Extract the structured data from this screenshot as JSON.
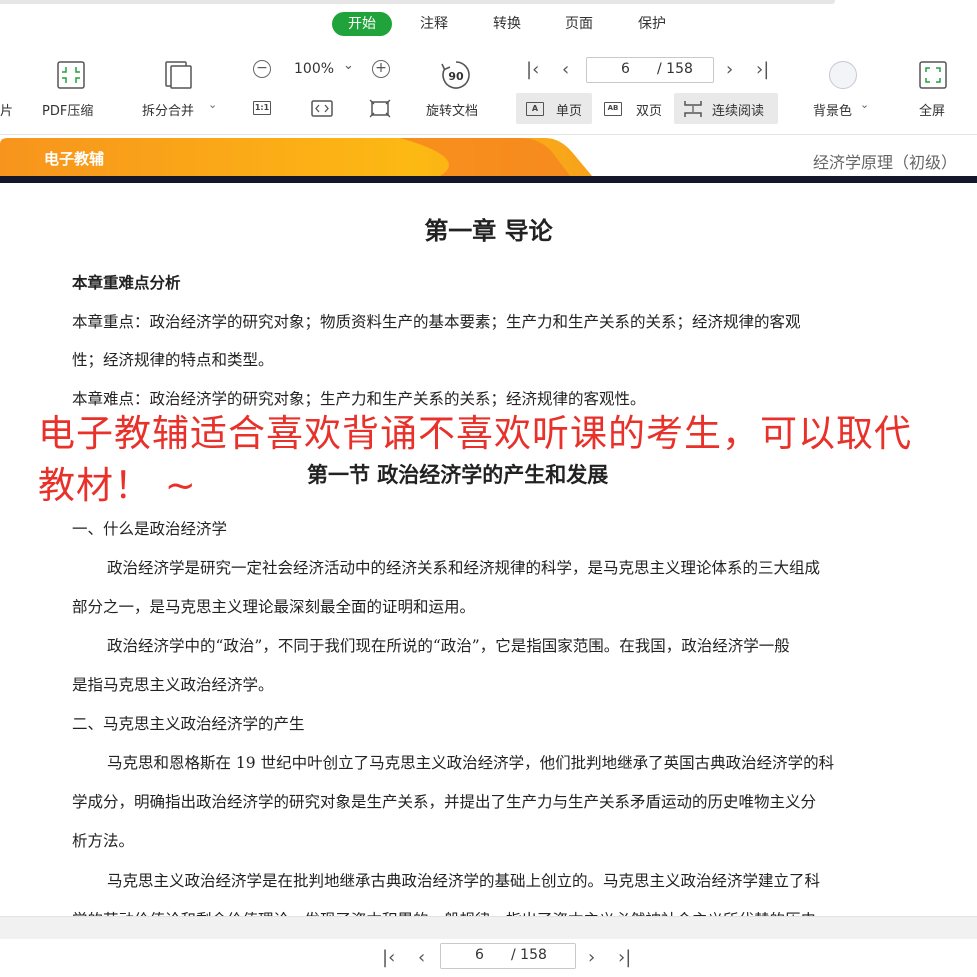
{
  "tabs": [
    {
      "label": "开始",
      "active": true
    },
    {
      "label": "注释"
    },
    {
      "label": "转换"
    },
    {
      "label": "页面"
    },
    {
      "label": "保护"
    }
  ],
  "toolbar": {
    "partial_left": "片",
    "pdf_compress": "PDF压缩",
    "split_merge": "拆分合并",
    "zoom_level": "100%",
    "actual_size": "1:1",
    "rotate_doc": "旋转文档",
    "rotate_badge": "90",
    "current_page": "6",
    "total_pages": "/ 158",
    "single_page": "单页",
    "double_page": "双页",
    "continuous": "连续阅读",
    "bg_color": "背景色",
    "fullscreen": "全屏"
  },
  "banner": {
    "left": "电子教辅",
    "right": "经济学原理（初级）"
  },
  "doc": {
    "chapter_title": "第一章 导论",
    "key_heading": "本章重难点分析",
    "key_points_1": "本章重点：政治经济学的研究对象；物质资料生产的基本要素；生产力和生产关系的关系；经济规律的客观",
    "key_points_2": "性；经济规律的特点和类型。",
    "difficult_points": "本章难点：政治经济学的研究对象；生产力和生产关系的关系；经济规律的客观性。",
    "section_title": "第一节 政治经济学的产生和发展",
    "sub1": "一、什么是政治经济学",
    "p1_1": "政治经济学是研究一定社会经济活动中的经济关系和经济规律的科学，是马克思主义理论体系的三大组成",
    "p1_2": "部分之一，是马克思主义理论最深刻最全面的证明和运用。",
    "p2_1": "政治经济学中的“政治”，不同于我们现在所说的“政治”，它是指国家范围。在我国，政治经济学一般",
    "p2_2": "是指马克思主义政治经济学。",
    "sub2": "二、马克思主义政治经济学的产生",
    "p3_1": "马克思和恩格斯在 19 世纪中叶创立了马克思主义政治经济学，他们批判地继承了英国古典政治经济学的科",
    "p3_2": "学成分，明确指出政治经济学的研究对象是生产关系，并提出了生产力与生产关系矛盾运动的历史唯物主义分",
    "p3_3": "析方法。",
    "p4_1": "马克思主义政治经济学是在批判地继承古典政治经济学的基础上创立的。马克思主义政治经济学建立了科",
    "p4_2": "学的劳动价值论和剩余价值理论，发现了资本积累的一般规律，指出了资本主义必然被社会主义所代替的历史"
  },
  "overlay_text": "电子教辅适合喜欢背诵不喜欢听课的考生，可以取代教材！ ~",
  "bottom": {
    "current_page": "6",
    "total_pages": "/ 158"
  },
  "colors": {
    "accent_green": "#21a33b",
    "banner_orange": "#f7941d",
    "banner_yellow": "#fdb913",
    "overlay_red": "#e8312a"
  }
}
